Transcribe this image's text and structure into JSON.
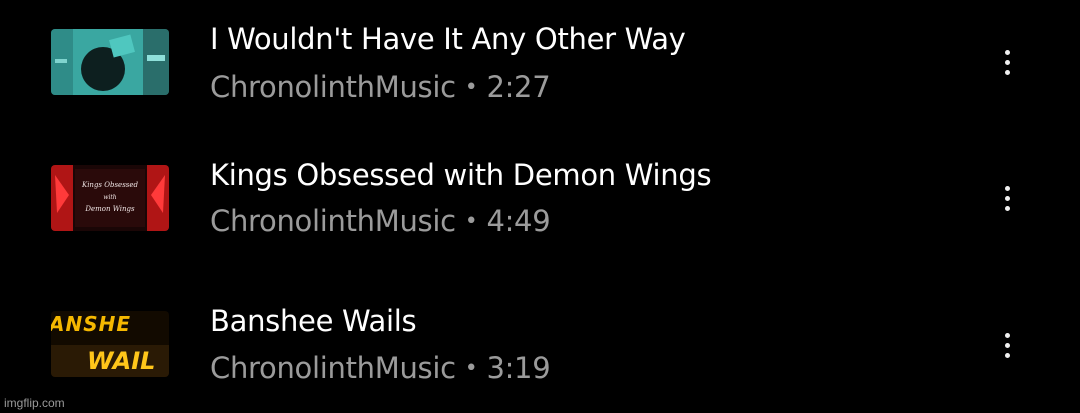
{
  "tracks": [
    {
      "title": "I Wouldn't Have It Any Other Way",
      "artist": "ChronolinthMusic",
      "separator": "•",
      "duration": "2:27",
      "thumbnail_icon": "teal-album-art",
      "accent": "#3fb3ad"
    },
    {
      "title": "Kings Obsessed with Demon Wings",
      "artist": "ChronolinthMusic",
      "separator": "•",
      "duration": "4:49",
      "thumbnail_icon": "red-demon-wings-art",
      "thumb_text": [
        "Kings Obsessed",
        "with",
        "Demon Wings"
      ],
      "accent": "#c41a1a"
    },
    {
      "title": "Banshee Wails",
      "artist": "ChronolinthMusic",
      "separator": "•",
      "duration": "3:19",
      "thumbnail_icon": "banshee-wails-art",
      "thumb_text": [
        "ANSHE",
        "WAIL"
      ],
      "accent": "#f0b400"
    }
  ],
  "watermark": "imgflip.com"
}
